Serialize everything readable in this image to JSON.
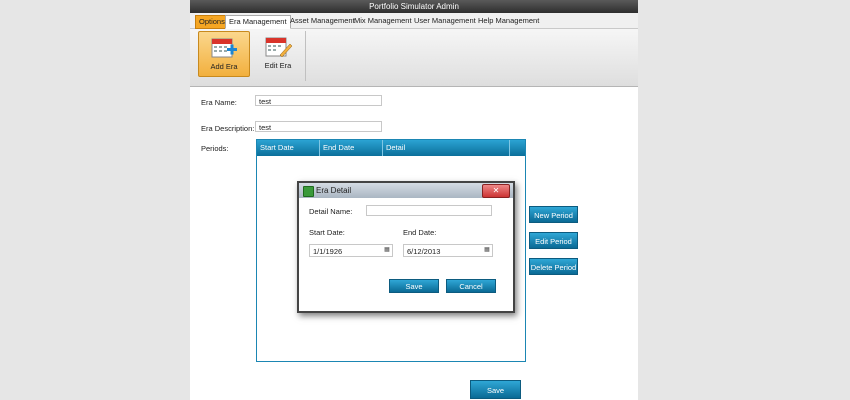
{
  "window": {
    "title": "Portfolio Simulator Admin"
  },
  "tabs": [
    {
      "label": "Options"
    },
    {
      "label": "Era Management"
    },
    {
      "label": "Asset Management"
    },
    {
      "label": "Mix Management"
    },
    {
      "label": "User Management"
    },
    {
      "label": "Help Management"
    }
  ],
  "ribbon": {
    "add_era": "Add Era",
    "edit_era": "Edit Era"
  },
  "form": {
    "era_name_label": "Era Name:",
    "era_name_value": "test",
    "era_desc_label": "Era Description:",
    "era_desc_value": "test",
    "periods_label": "Periods:"
  },
  "periods_grid": {
    "columns": [
      "Start Date",
      "End Date",
      "Detail"
    ]
  },
  "side_buttons": {
    "new_period": "New Period",
    "edit_period": "Edit Period",
    "delete_period": "Delete Period"
  },
  "save_button": "Save",
  "dialog": {
    "title": "Era Detail",
    "close": "✕",
    "detail_name_label": "Detail Name:",
    "detail_name_value": "",
    "start_date_label": "Start Date:",
    "start_date_value": "1/1/1926",
    "end_date_label": "End Date:",
    "end_date_value": "6/12/2013",
    "save": "Save",
    "cancel": "Cancel"
  },
  "colors": {
    "accent": "#1b86b3",
    "options_tab": "#f5a623"
  }
}
